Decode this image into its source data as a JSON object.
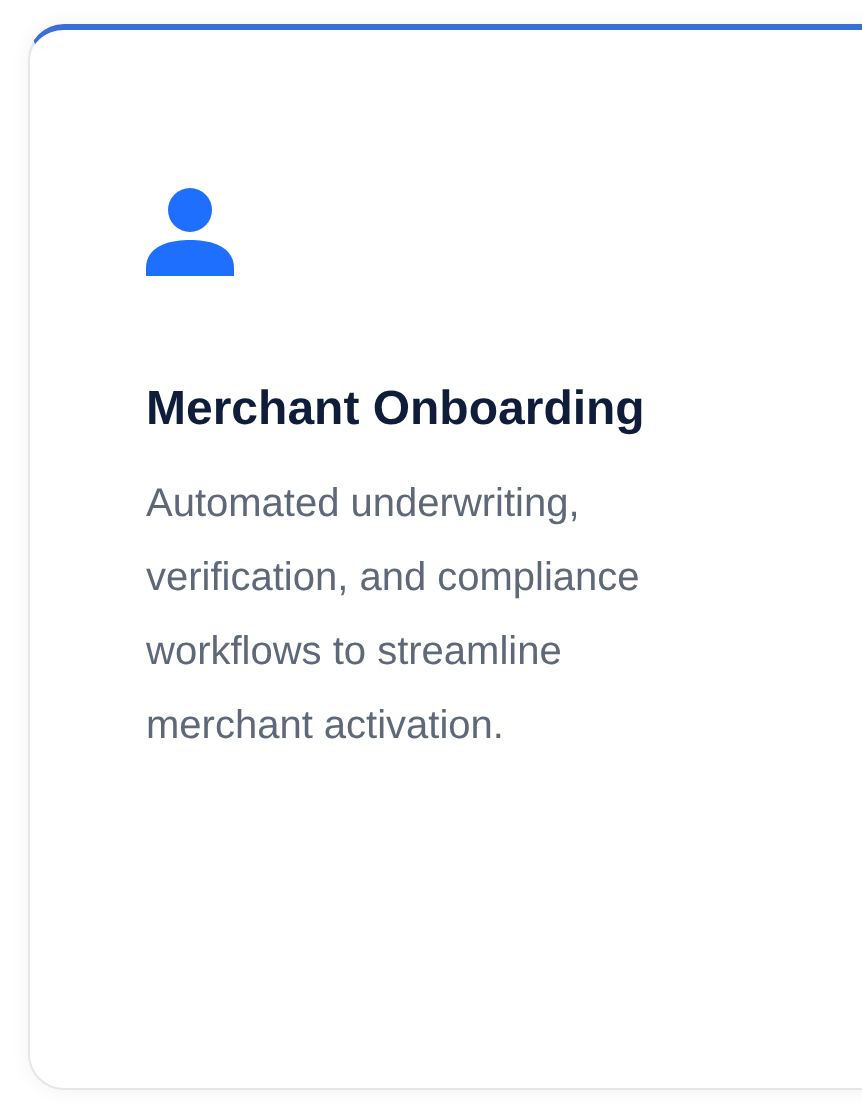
{
  "card": {
    "title": "Merchant Onboarding",
    "description": "Automated underwriting, verification, and compliance workflows to streamline merchant activation."
  }
}
